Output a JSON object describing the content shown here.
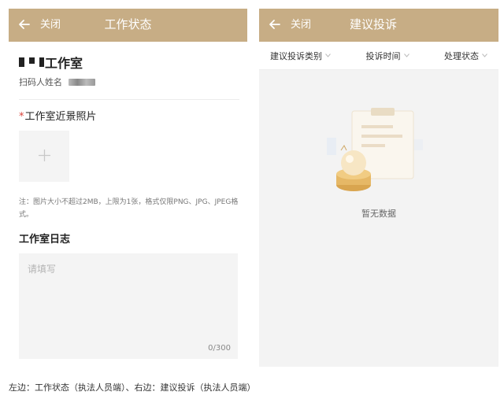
{
  "left": {
    "titlebar": {
      "close_label": "关闭",
      "title": "工作状态"
    },
    "studio": {
      "name_suffix": "工作室",
      "scanner_label": "扫码人姓名"
    },
    "photo_section": {
      "required_mark": "*",
      "label": "工作室近景照片"
    },
    "upload_note": "注：图片大小不超过2MB，上限为1张，格式仅限PNG、JPG、JPEG格式。",
    "log_section": {
      "label": "工作室日志",
      "placeholder": "请填写",
      "counter": "0/300"
    }
  },
  "right": {
    "titlebar": {
      "close_label": "关闭",
      "title": "建议投诉"
    },
    "filters": [
      {
        "label": "建议投诉类别"
      },
      {
        "label": "投诉时间"
      },
      {
        "label": "处理状态"
      }
    ],
    "empty_text": "暂无数据"
  },
  "caption": "左边：工作状态（执法人员端）、右边：建议投诉（执法人员端）",
  "colors": {
    "titlebar": "#c7ad85",
    "required": "#d9433a"
  },
  "icons": {
    "back": "arrow-left-icon",
    "add": "plus-icon",
    "caret": "chevron-down-icon",
    "empty": "empty-clipboard-illustration"
  }
}
